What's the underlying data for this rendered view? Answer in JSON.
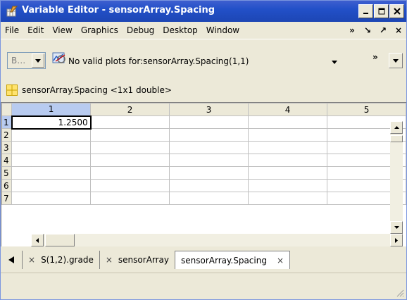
{
  "window": {
    "title": "Variable Editor - sensorArray.Spacing",
    "controls": {
      "minimize": "minimize",
      "maximize": "maximize",
      "close": "close"
    }
  },
  "menu": {
    "items": [
      "File",
      "Edit",
      "View",
      "Graphics",
      "Debug",
      "Desktop",
      "Window"
    ],
    "overflow": "»",
    "dock": "↘",
    "undock": "↗",
    "close": "×"
  },
  "toolbar": {
    "combo_value": "B…",
    "plot_text": "No valid plots for:sensorArray.Spacing(1,1)",
    "overflow": "»"
  },
  "variable": {
    "label": "sensorArray.Spacing <1x1 double>"
  },
  "grid": {
    "columns": [
      "1",
      "2",
      "3",
      "4",
      "5"
    ],
    "rows": [
      "1",
      "2",
      "3",
      "4",
      "5",
      "6",
      "7"
    ],
    "cells": [
      [
        "1.2500",
        "",
        "",
        "",
        ""
      ],
      [
        "",
        "",
        "",
        "",
        ""
      ],
      [
        "",
        "",
        "",
        "",
        ""
      ],
      [
        "",
        "",
        "",
        "",
        ""
      ],
      [
        "",
        "",
        "",
        "",
        ""
      ],
      [
        "",
        "",
        "",
        "",
        ""
      ],
      [
        "",
        "",
        "",
        "",
        ""
      ]
    ],
    "active_cell": "1,1"
  },
  "tabs": [
    {
      "label": "S(1,2).grade",
      "close": "×",
      "active": false
    },
    {
      "label": "sensorArray",
      "close": "×",
      "active": false
    },
    {
      "label": "sensorArray.Spacing",
      "close": "×",
      "active": true
    }
  ],
  "colors": {
    "titlebar": "#2250c8",
    "selection_header": "#b8cbf0",
    "chrome": "#ece9d8"
  }
}
